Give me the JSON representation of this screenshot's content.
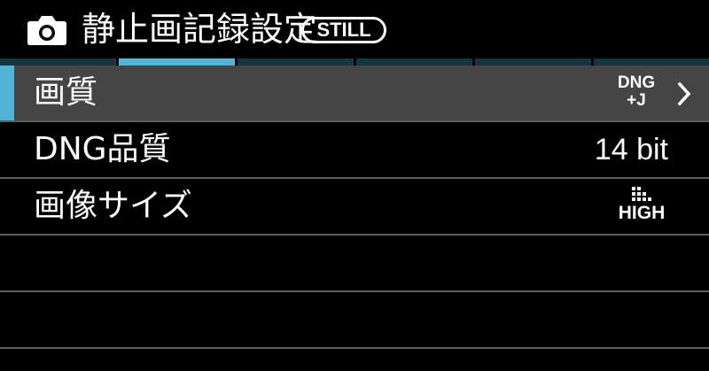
{
  "header": {
    "icon": "camera-icon",
    "title": "静止画記録設定",
    "badge": "STILL"
  },
  "tabs": {
    "count": 6,
    "active_index": 1,
    "active_color": "#4fb4d6",
    "inactive_color": "#163441"
  },
  "menu": {
    "selected_color": "#454545",
    "items": [
      {
        "label": "画質",
        "value_line1": "DNG",
        "value_line2": "+J",
        "has_submenu": true,
        "icon": "chevron-right-icon"
      },
      {
        "label": "DNG品質",
        "value": "14 bit"
      },
      {
        "label": "画像サイズ",
        "value_icon": "image-size-grid-icon",
        "value_line2": "HIGH"
      },
      {
        "label": ""
      },
      {
        "label": ""
      },
      {
        "label": ""
      }
    ]
  }
}
